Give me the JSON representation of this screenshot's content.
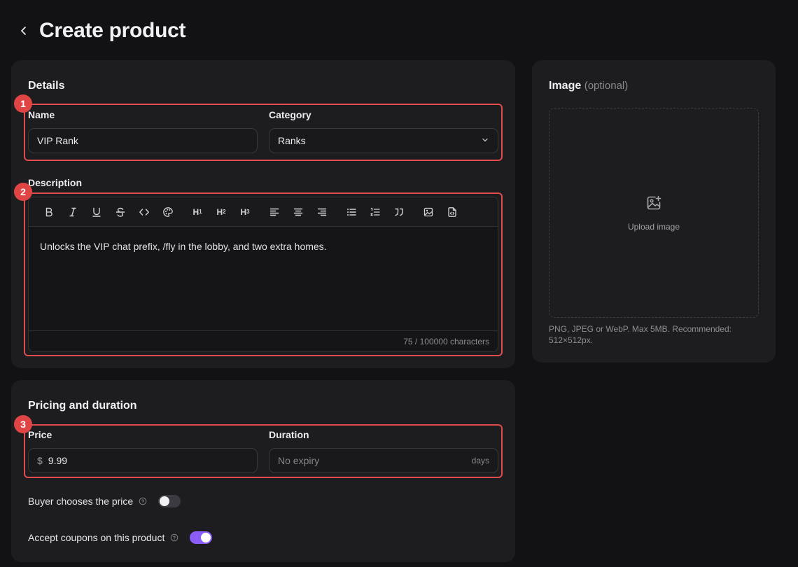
{
  "header": {
    "title": "Create product"
  },
  "details": {
    "title": "Details",
    "name_label": "Name",
    "name_value": "VIP Rank",
    "category_label": "Category",
    "category_value": "Ranks",
    "description_label": "Description",
    "description_text": "Unlocks the VIP chat prefix, /fly in the lobby, and two extra homes.",
    "char_count": "75 / 100000 characters",
    "toolbar": {
      "h1": "H",
      "h1_sub": "1",
      "h2": "H",
      "h2_sub": "2",
      "h3": "H",
      "h3_sub": "3"
    }
  },
  "image": {
    "title": "Image",
    "optional": "(optional)",
    "upload_label": "Upload image",
    "hint": "PNG, JPEG or WebP. Max 5MB. Recommended: 512×512px."
  },
  "pricing": {
    "title": "Pricing and duration",
    "price_label": "Price",
    "currency_symbol": "$",
    "price_value": "9.99",
    "duration_label": "Duration",
    "duration_placeholder": "No expiry",
    "duration_unit": "days",
    "buyer_price_label": "Buyer chooses the price",
    "buyer_price_enabled": false,
    "coupons_label": "Accept coupons on this product",
    "coupons_enabled": true
  },
  "annotations": {
    "badge1": "1",
    "badge2": "2",
    "badge3": "3"
  },
  "colors": {
    "background": "#121214",
    "card": "#1d1d20",
    "highlight": "#e04b4b",
    "accent": "#8b5cf6"
  }
}
